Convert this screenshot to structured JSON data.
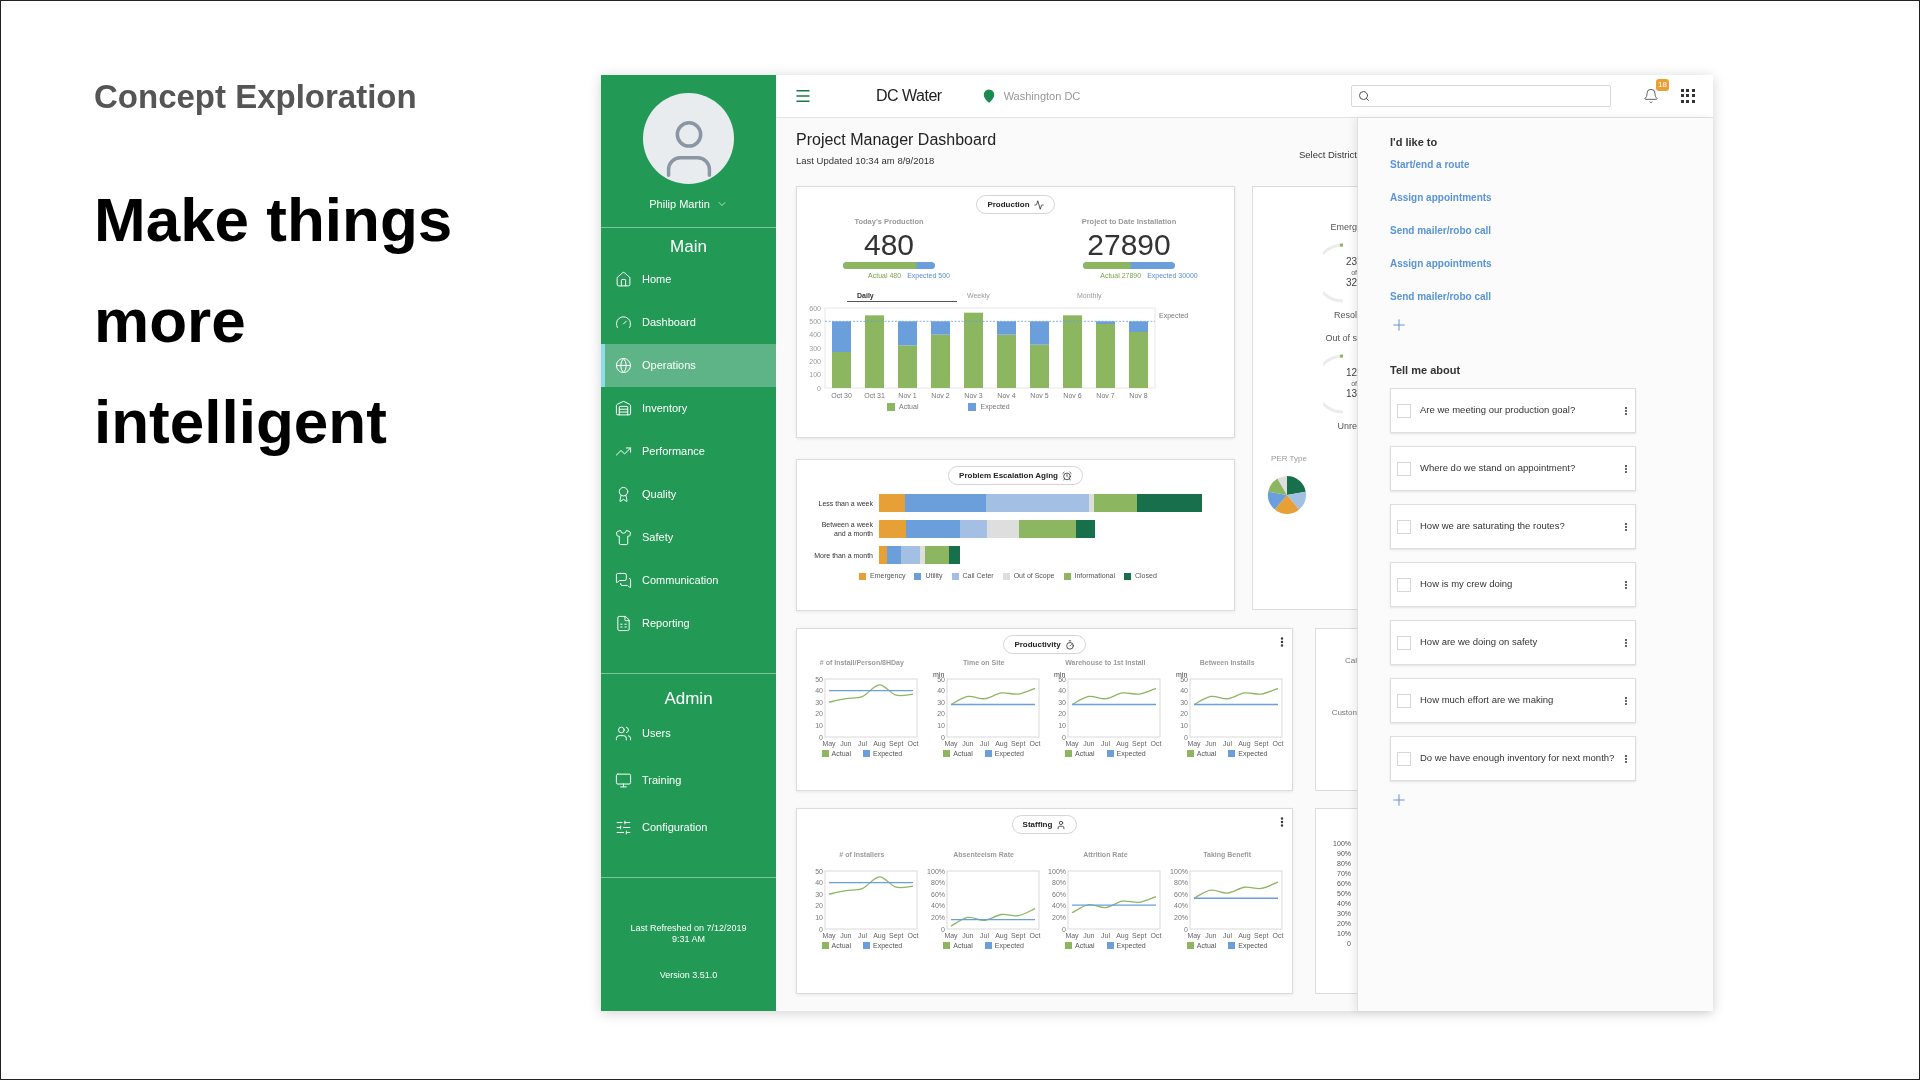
{
  "slide": {
    "kicker": "Concept Exploration",
    "headline_lines": [
      "Make things",
      "more",
      "intelligent"
    ]
  },
  "sidebar": {
    "user": "Philip Martin",
    "main_heading": "Main",
    "main_items": [
      {
        "label": "Home",
        "selected": false
      },
      {
        "label": "Dashboard",
        "selected": false
      },
      {
        "label": "Operations",
        "selected": true
      },
      {
        "label": "Inventory",
        "selected": false
      },
      {
        "label": "Performance",
        "selected": false
      },
      {
        "label": "Quality",
        "selected": false
      },
      {
        "label": "Safety",
        "selected": false
      },
      {
        "label": "Communication",
        "selected": false
      },
      {
        "label": "Reporting",
        "selected": false
      }
    ],
    "admin_heading": "Admin",
    "admin_items": [
      {
        "label": "Users",
        "selected": false
      },
      {
        "label": "Training",
        "selected": false
      },
      {
        "label": "Configuration",
        "selected": false
      }
    ],
    "footer_lines": [
      "Last Refreshed on 7/12/2019",
      "9:31 AM"
    ],
    "version": "Version 3.51.0"
  },
  "topbar": {
    "app_name": "DC Water",
    "location": "Washington DC",
    "notification_count": "18"
  },
  "dashboard": {
    "title": "Project Manager Dashboard",
    "updated": "Last Updated 10:34 am 8/9/2018",
    "select_district": "Select District",
    "production": {
      "pill": "Production",
      "kpis": [
        {
          "label": "Today's Production",
          "value": "480",
          "level": 0.8,
          "actual": "Actual 480",
          "expected": "Expected 500"
        },
        {
          "label": "Project to Date Installation",
          "value": "27890",
          "level": 0.52,
          "actual": "Actual 27890",
          "expected": "Expected 30000"
        }
      ],
      "tabs": [
        {
          "label": "Daily",
          "selected": true
        },
        {
          "label": "Weekly",
          "selected": false
        },
        {
          "label": "Monthly",
          "selected": false
        }
      ],
      "chart_data": {
        "type": "bar",
        "categories": [
          "Oct 30",
          "Oct 31",
          "Nov 1",
          "Nov 2",
          "Nov 3",
          "Nov 4",
          "Nov 5",
          "Nov 6",
          "Nov 7",
          "Nov 8"
        ],
        "series": [
          {
            "name": "Actual",
            "color": "#8db661",
            "values": [
              270,
              545,
              320,
              400,
              565,
              400,
              325,
              545,
              480,
              420
            ]
          },
          {
            "name": "Expected",
            "color": "#6a9fdc",
            "values": [
              230,
              0,
              180,
              100,
              0,
              100,
              175,
              0,
              20,
              80
            ]
          }
        ],
        "ylim": [
          0,
          600
        ],
        "yticks": [
          0,
          100,
          200,
          300,
          400,
          500,
          600
        ],
        "stacked": true,
        "legend": "bottom",
        "ref_lines": [
          {
            "axis": "y",
            "value": 500,
            "label": "Expected",
            "color": "#6a9fdc"
          }
        ]
      }
    },
    "escalation": {
      "pill": "Problem Escalation Aging",
      "rows": [
        {
          "lines": [
            "Less than a week"
          ]
        },
        {
          "lines": [
            "Between a week",
            "and a month"
          ]
        },
        {
          "lines": [
            "More than a month"
          ]
        }
      ],
      "legend": [
        {
          "label": "Emergency",
          "color": "#e6a035"
        },
        {
          "label": "Utility",
          "color": "#6a9fdc"
        },
        {
          "label": "Call Ceter",
          "color": "#a4bfe4"
        },
        {
          "label": "Out of Scope",
          "color": "#dedede"
        },
        {
          "label": "Informational",
          "color": "#8db661"
        },
        {
          "label": "Closed",
          "color": "#17704b"
        }
      ]
    },
    "status_card": {
      "sections": [
        {
          "label": "Emerg",
          "count": "23",
          "of": "of",
          "total": "32",
          "footer": "Resol"
        },
        {
          "label": "Out of s",
          "count": "12",
          "of": "of",
          "total": "13",
          "footer": "Unre"
        }
      ],
      "pie_title": "PER Type"
    },
    "productivity": {
      "pill": "Productivity",
      "charts": [
        {
          "chart_data": {
            "type": "line",
            "title": "# of Install/Person/8HDay",
            "categories": [
              "May",
              "Jun",
              "Jul",
              "Aug",
              "Sept",
              "Oct"
            ],
            "ylim": [
              0,
              50
            ],
            "yticks": [
              0,
              10,
              20,
              30,
              40,
              50
            ],
            "legend": "bottom",
            "series": [
              {
                "name": "Actual",
                "color": "#8db661",
                "values": [
                  30,
                  33,
                  35,
                  45,
                  36,
                  37
                ]
              },
              {
                "name": "Expected",
                "color": "#6a9fdc",
                "values": [
                  40,
                  40,
                  40,
                  40,
                  40,
                  40
                ]
              }
            ]
          }
        },
        {
          "chart_data": {
            "type": "line",
            "title": "Time on Site",
            "ylabel": "min",
            "categories": [
              "May",
              "Jun",
              "Jul",
              "Aug",
              "Sept",
              "Oct"
            ],
            "ylim": [
              0,
              50
            ],
            "yticks": [
              0,
              10,
              20,
              30,
              40,
              50
            ],
            "legend": "bottom",
            "series": [
              {
                "name": "Actual",
                "color": "#8db661",
                "values": [
                  28,
                  35,
                  33,
                  38,
                  37,
                  42
                ]
              },
              {
                "name": "Expected",
                "color": "#6a9fdc",
                "values": [
                  28,
                  28,
                  28,
                  28,
                  28,
                  28
                ]
              }
            ]
          }
        },
        {
          "chart_data": {
            "type": "line",
            "title": "Warehouse to 1st Install",
            "ylabel": "min",
            "categories": [
              "May",
              "Jun",
              "Jul",
              "Aug",
              "Sept",
              "Oct"
            ],
            "ylim": [
              0,
              50
            ],
            "yticks": [
              0,
              10,
              20,
              30,
              40,
              50
            ],
            "legend": "bottom",
            "series": [
              {
                "name": "Actual",
                "color": "#8db661",
                "values": [
                  28,
                  35,
                  33,
                  38,
                  37,
                  42
                ]
              },
              {
                "name": "Expected",
                "color": "#6a9fdc",
                "values": [
                  28,
                  28,
                  28,
                  28,
                  28,
                  28
                ]
              }
            ]
          }
        },
        {
          "chart_data": {
            "type": "line",
            "title": "Between Installs",
            "ylabel": "min",
            "categories": [
              "May",
              "Jun",
              "Jul",
              "Aug",
              "Sept",
              "Oct"
            ],
            "ylim": [
              0,
              50
            ],
            "yticks": [
              0,
              10,
              20,
              30,
              40,
              50
            ],
            "legend": "bottom",
            "series": [
              {
                "name": "Actual",
                "color": "#8db661",
                "values": [
                  28,
                  35,
                  33,
                  38,
                  37,
                  42
                ]
              },
              {
                "name": "Expected",
                "color": "#6a9fdc",
                "values": [
                  28,
                  28,
                  28,
                  28,
                  28,
                  28
                ]
              }
            ]
          }
        }
      ],
      "side_texts": [
        "Cal",
        "Custon"
      ]
    },
    "staffing": {
      "pill": "Staffing",
      "charts": [
        {
          "chart_data": {
            "type": "line",
            "title": "# of Installers",
            "categories": [
              "May",
              "Jun",
              "Jul",
              "Aug",
              "Sept",
              "Oct"
            ],
            "ylim": [
              0,
              50
            ],
            "yticks": [
              0,
              10,
              20,
              30,
              40,
              50
            ],
            "legend": "bottom",
            "series": [
              {
                "name": "Actual",
                "color": "#8db661",
                "values": [
                  30,
                  33,
                  35,
                  45,
                  36,
                  37
                ]
              },
              {
                "name": "Expected",
                "color": "#6a9fdc",
                "values": [
                  40,
                  40,
                  40,
                  40,
                  40,
                  40
                ]
              }
            ]
          }
        },
        {
          "chart_data": {
            "type": "line",
            "title": "Absenteeism Rate",
            "categories": [
              "May",
              "Jun",
              "Jul",
              "Aug",
              "Sept",
              "Oct"
            ],
            "ylim": [
              0,
              100
            ],
            "yticks": [
              0,
              {
                "value": 20,
                "label": "20%"
              },
              {
                "value": 40,
                "label": "40%"
              },
              {
                "value": 60,
                "label": "60%"
              },
              {
                "value": 80,
                "label": "80%"
              },
              {
                "value": 100,
                "label": "100%"
              }
            ],
            "legend": "bottom",
            "series": [
              {
                "name": "Actual",
                "color": "#8db661",
                "values": [
                  5,
                  20,
                  15,
                  25,
                  23,
                  35
                ]
              },
              {
                "name": "Expected",
                "color": "#6a9fdc",
                "values": [
                  16,
                  16,
                  16,
                  16,
                  16,
                  16
                ]
              }
            ]
          }
        },
        {
          "chart_data": {
            "type": "line",
            "title": "Attrition Rate",
            "categories": [
              "May",
              "Jun",
              "Jul",
              "Aug",
              "Sept",
              "Oct"
            ],
            "ylim": [
              0,
              100
            ],
            "yticks": [
              0,
              {
                "value": 20,
                "label": "20%"
              },
              {
                "value": 40,
                "label": "40%"
              },
              {
                "value": 60,
                "label": "60%"
              },
              {
                "value": 80,
                "label": "80%"
              },
              {
                "value": 100,
                "label": "100%"
              }
            ],
            "legend": "bottom",
            "series": [
              {
                "name": "Actual",
                "color": "#8db661",
                "values": [
                  28,
                  42,
                  37,
                  48,
                  46,
                  56
                ]
              },
              {
                "name": "Expected",
                "color": "#6a9fdc",
                "values": [
                  41,
                  41,
                  41,
                  41,
                  41,
                  41
                ]
              }
            ]
          }
        },
        {
          "chart_data": {
            "type": "line",
            "title": "Taking Benefit",
            "categories": [
              "May",
              "Jun",
              "Jul",
              "Aug",
              "Sept",
              "Oct"
            ],
            "ylim": [
              0,
              100
            ],
            "yticks": [
              0,
              {
                "value": 20,
                "label": "20%"
              },
              {
                "value": 40,
                "label": "40%"
              },
              {
                "value": 60,
                "label": "60%"
              },
              {
                "value": 80,
                "label": "80%"
              },
              {
                "value": 100,
                "label": "100%"
              }
            ],
            "legend": "bottom",
            "series": [
              {
                "name": "Actual",
                "color": "#8db661",
                "values": [
                  53,
                  67,
                  62,
                  72,
                  70,
                  81
                ]
              },
              {
                "name": "Expected",
                "color": "#6a9fdc",
                "values": [
                  53,
                  53,
                  53,
                  53,
                  53,
                  53
                ]
              }
            ]
          }
        }
      ],
      "side_axis_labels": [
        "100%",
        "90%",
        "80%",
        "70%",
        "60%",
        "50%",
        "40%",
        "30%",
        "20%",
        "10%",
        "0"
      ]
    }
  },
  "panel": {
    "actions_heading": "I'd like to",
    "actions": [
      "Start/end a route",
      "Assign appointments",
      "Send mailer/robo call",
      "Assign appointments",
      "Send mailer/robo call"
    ],
    "questions_heading": "Tell me about",
    "questions": [
      {
        "text": "Are we meeting our production goal?",
        "checked": false
      },
      {
        "text": "Where do we stand on appointment?",
        "checked": false
      },
      {
        "text": "How we are saturating the routes?",
        "checked": false
      },
      {
        "text": "How is my crew doing",
        "checked": false
      },
      {
        "text": "How are we doing on safety",
        "checked": false
      },
      {
        "text": "How much effort are we making",
        "checked": false
      },
      {
        "text": "Do we have enough inventory for next month?",
        "checked": false
      }
    ]
  }
}
